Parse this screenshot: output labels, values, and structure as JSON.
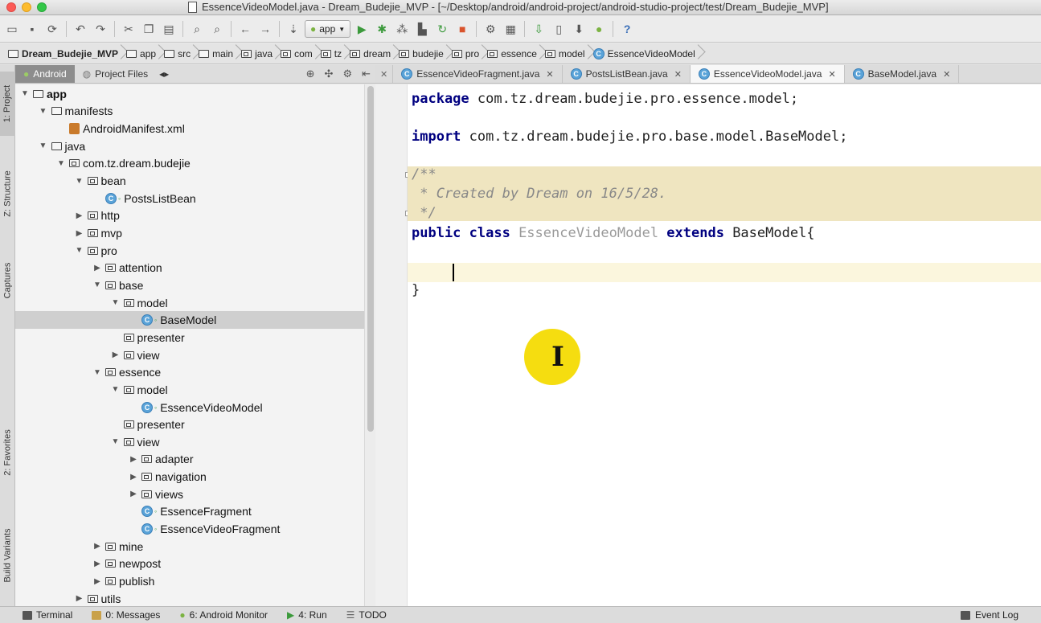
{
  "window": {
    "title": "EssenceVideoModel.java - Dream_Budejie_MVP - [~/Desktop/android/android-project/android-studio-project/test/Dream_Budejie_MVP]"
  },
  "toolbar": {
    "run_config": "app",
    "help": "?"
  },
  "breadcrumb": [
    "Dream_Budejie_MVP",
    "app",
    "src",
    "main",
    "java",
    "com",
    "tz",
    "dream",
    "budejie",
    "pro",
    "essence",
    "model",
    "EssenceVideoModel"
  ],
  "left_strip": [
    "1: Project",
    "Z: Structure",
    "Captures",
    "2: Favorites",
    "Build Variants"
  ],
  "project_panel": {
    "tab_android": "Android",
    "tab_project_files": "Project Files"
  },
  "tree": [
    {
      "label": "app",
      "depth": 0,
      "arrow": "▼",
      "icon": "module",
      "bold": true
    },
    {
      "label": "manifests",
      "depth": 1,
      "arrow": "▼",
      "icon": "folder"
    },
    {
      "label": "AndroidManifest.xml",
      "depth": 2,
      "arrow": "",
      "icon": "manifest"
    },
    {
      "label": "java",
      "depth": 1,
      "arrow": "▼",
      "icon": "folder"
    },
    {
      "label": "com.tz.dream.budejie",
      "depth": 2,
      "arrow": "▼",
      "icon": "pkg"
    },
    {
      "label": "bean",
      "depth": 3,
      "arrow": "▼",
      "icon": "pkg"
    },
    {
      "label": "PostsListBean",
      "depth": 4,
      "arrow": "",
      "icon": "class"
    },
    {
      "label": "http",
      "depth": 3,
      "arrow": "▶",
      "icon": "pkg"
    },
    {
      "label": "mvp",
      "depth": 3,
      "arrow": "▶",
      "icon": "pkg"
    },
    {
      "label": "pro",
      "depth": 3,
      "arrow": "▼",
      "icon": "pkg"
    },
    {
      "label": "attention",
      "depth": 4,
      "arrow": "▶",
      "icon": "pkg"
    },
    {
      "label": "base",
      "depth": 4,
      "arrow": "▼",
      "icon": "pkg"
    },
    {
      "label": "model",
      "depth": 5,
      "arrow": "▼",
      "icon": "pkg"
    },
    {
      "label": "BaseModel",
      "depth": 6,
      "arrow": "",
      "icon": "class",
      "selected": true
    },
    {
      "label": "presenter",
      "depth": 5,
      "arrow": "",
      "icon": "pkg"
    },
    {
      "label": "view",
      "depth": 5,
      "arrow": "▶",
      "icon": "pkg"
    },
    {
      "label": "essence",
      "depth": 4,
      "arrow": "▼",
      "icon": "pkg"
    },
    {
      "label": "model",
      "depth": 5,
      "arrow": "▼",
      "icon": "pkg"
    },
    {
      "label": "EssenceVideoModel",
      "depth": 6,
      "arrow": "",
      "icon": "class"
    },
    {
      "label": "presenter",
      "depth": 5,
      "arrow": "",
      "icon": "pkg"
    },
    {
      "label": "view",
      "depth": 5,
      "arrow": "▼",
      "icon": "pkg"
    },
    {
      "label": "adapter",
      "depth": 6,
      "arrow": "▶",
      "icon": "pkg"
    },
    {
      "label": "navigation",
      "depth": 6,
      "arrow": "▶",
      "icon": "pkg"
    },
    {
      "label": "views",
      "depth": 6,
      "arrow": "▶",
      "icon": "pkg"
    },
    {
      "label": "EssenceFragment",
      "depth": 6,
      "arrow": "",
      "icon": "class"
    },
    {
      "label": "EssenceVideoFragment",
      "depth": 6,
      "arrow": "",
      "icon": "class"
    },
    {
      "label": "mine",
      "depth": 4,
      "arrow": "▶",
      "icon": "pkg"
    },
    {
      "label": "newpost",
      "depth": 4,
      "arrow": "▶",
      "icon": "pkg"
    },
    {
      "label": "publish",
      "depth": 4,
      "arrow": "▶",
      "icon": "pkg"
    },
    {
      "label": "utils",
      "depth": 3,
      "arrow": "▶",
      "icon": "pkg"
    }
  ],
  "editor_tabs": [
    {
      "label": "EssenceVideoFragment.java",
      "active": false
    },
    {
      "label": "PostsListBean.java",
      "active": false
    },
    {
      "label": "EssenceVideoModel.java",
      "active": true
    },
    {
      "label": "BaseModel.java",
      "active": false
    }
  ],
  "code": {
    "l1_kw": "package",
    "l1_rest": " com.tz.dream.budejie.pro.essence.model;",
    "l2_kw": "import",
    "l2_rest": " com.tz.dream.budejie.pro.base.model.BaseModel;",
    "c1": "/**",
    "c2": " * Created by Dream on 16/5/28.",
    "c3": " */",
    "l4_kw1": "public class",
    "l4_name": " EssenceVideoModel ",
    "l4_kw2": "extends",
    "l4_rest": " BaseModel{",
    "l6": "}"
  },
  "bottom_bar": {
    "terminal": "Terminal",
    "messages": "0: Messages",
    "android_monitor": "6: Android Monitor",
    "run": "4: Run",
    "todo": "TODO",
    "event_log": "Event Log"
  }
}
